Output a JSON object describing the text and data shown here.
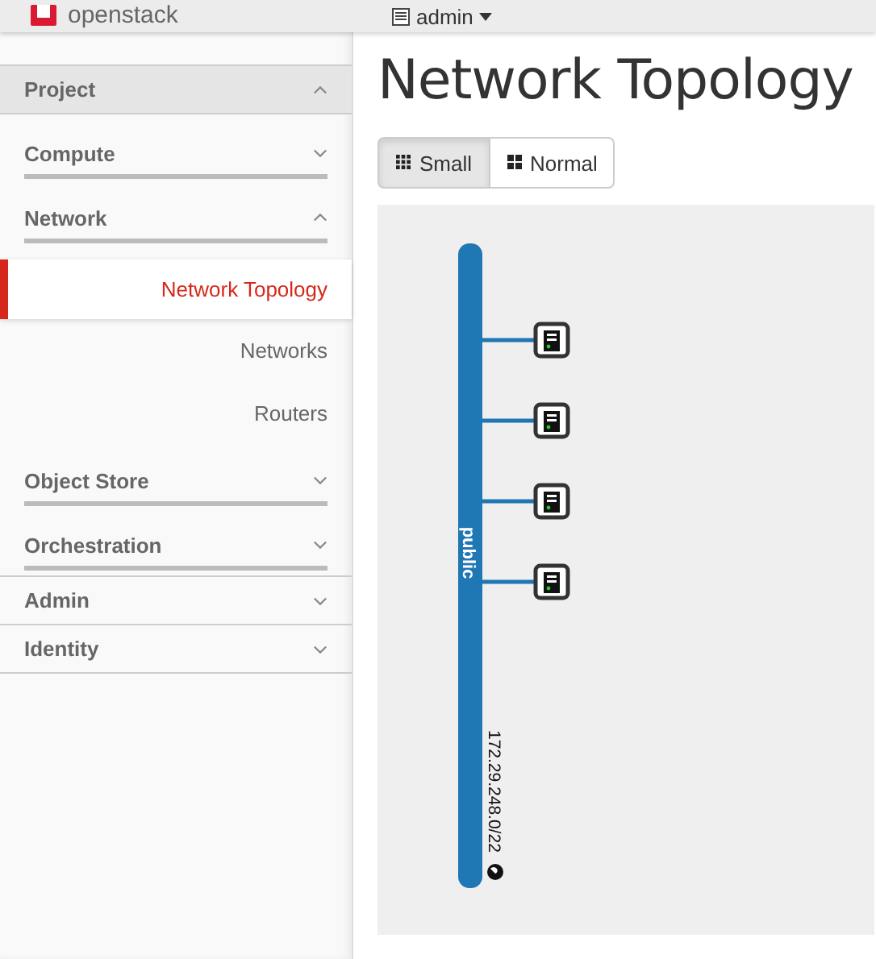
{
  "header": {
    "logo": "openstack",
    "user": "admin"
  },
  "sidebar": [
    {
      "label": "Project",
      "expanded": true,
      "children": [
        {
          "label": "Compute",
          "expanded": false
        },
        {
          "label": "Network",
          "expanded": true,
          "children": [
            {
              "label": "Network Topology",
              "selected": true
            },
            {
              "label": "Networks",
              "selected": false
            },
            {
              "label": "Routers",
              "selected": false
            }
          ]
        },
        {
          "label": "Object Store",
          "expanded": false
        },
        {
          "label": "Orchestration",
          "expanded": false
        }
      ]
    },
    {
      "label": "Admin",
      "expanded": false
    },
    {
      "label": "Identity",
      "expanded": false
    }
  ],
  "page_title": "Network Topology",
  "view_buttons": [
    {
      "label": "Small",
      "selected": true
    },
    {
      "label": "Normal",
      "selected": false
    }
  ],
  "topology": {
    "network": "public",
    "cidr": "172.29.248.0/22",
    "instances": [
      {
        "running": true
      },
      {
        "running": true
      },
      {
        "running": true
      },
      {
        "running": true
      }
    ]
  }
}
